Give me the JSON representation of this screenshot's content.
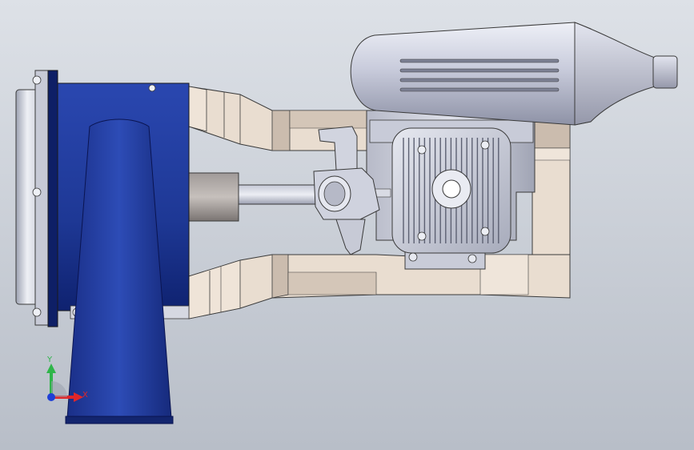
{
  "viewport": {
    "background_top": "#dde1e7",
    "background_bottom": "#b8bec8"
  },
  "model": {
    "parts": [
      "flange-plate",
      "blower-housing",
      "blower-outlet",
      "shaft-coupler",
      "drive-shaft",
      "upper-mount-rail",
      "lower-mount-rail",
      "muffler",
      "engine-crankcase",
      "cylinder-head",
      "carburetor"
    ],
    "colors": {
      "housing_blue": "#1f3a99",
      "housing_dark": "#0e1f66",
      "rail_beige": "#e9ddd0",
      "rail_shade": "#cbbcae",
      "metal_light": "#d8dbe6",
      "metal_mid": "#a9adbd",
      "metal_dark": "#7c8193"
    }
  },
  "triad": {
    "x_label": "X",
    "y_label": "Y",
    "x_color": "#e0262a",
    "y_color": "#2fb54a",
    "z_color": "#1e3fd6"
  }
}
